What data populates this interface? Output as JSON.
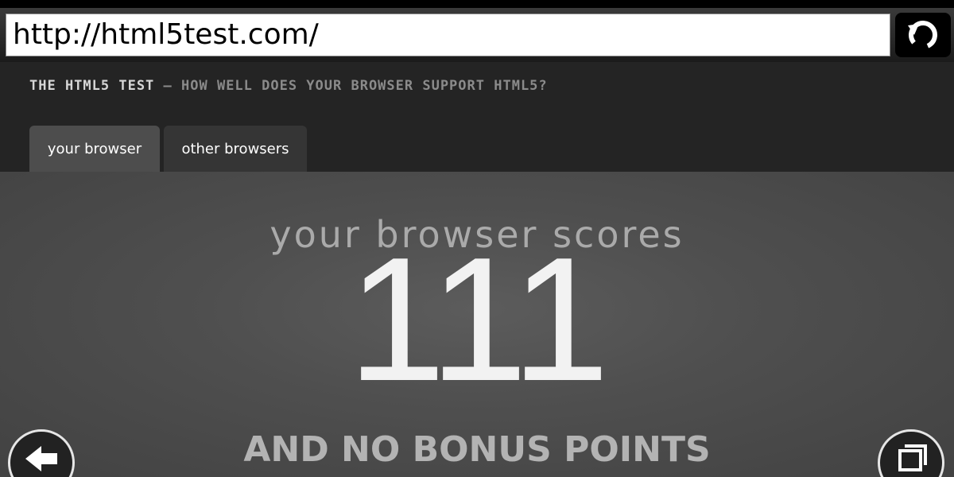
{
  "browser": {
    "url": "http://html5test.com/"
  },
  "header": {
    "site_name": "THE HTML5 TEST",
    "separator": " – ",
    "tagline": "HOW WELL DOES YOUR BROWSER SUPPORT HTML5?"
  },
  "tabs": [
    {
      "label": "your browser",
      "active": true
    },
    {
      "label": "other browsers",
      "active": false
    }
  ],
  "score": {
    "label": "your browser scores",
    "value": "111",
    "bonus": "AND NO BONUS POINTS"
  },
  "icons": {
    "reload": "reload-icon",
    "back": "back-arrow-icon",
    "windows": "windows-icon"
  },
  "colors": {
    "header_bg": "#242424",
    "active_tab": "#4d4d4d",
    "inactive_tab": "#353535",
    "score_text": "#f2f2f2"
  }
}
